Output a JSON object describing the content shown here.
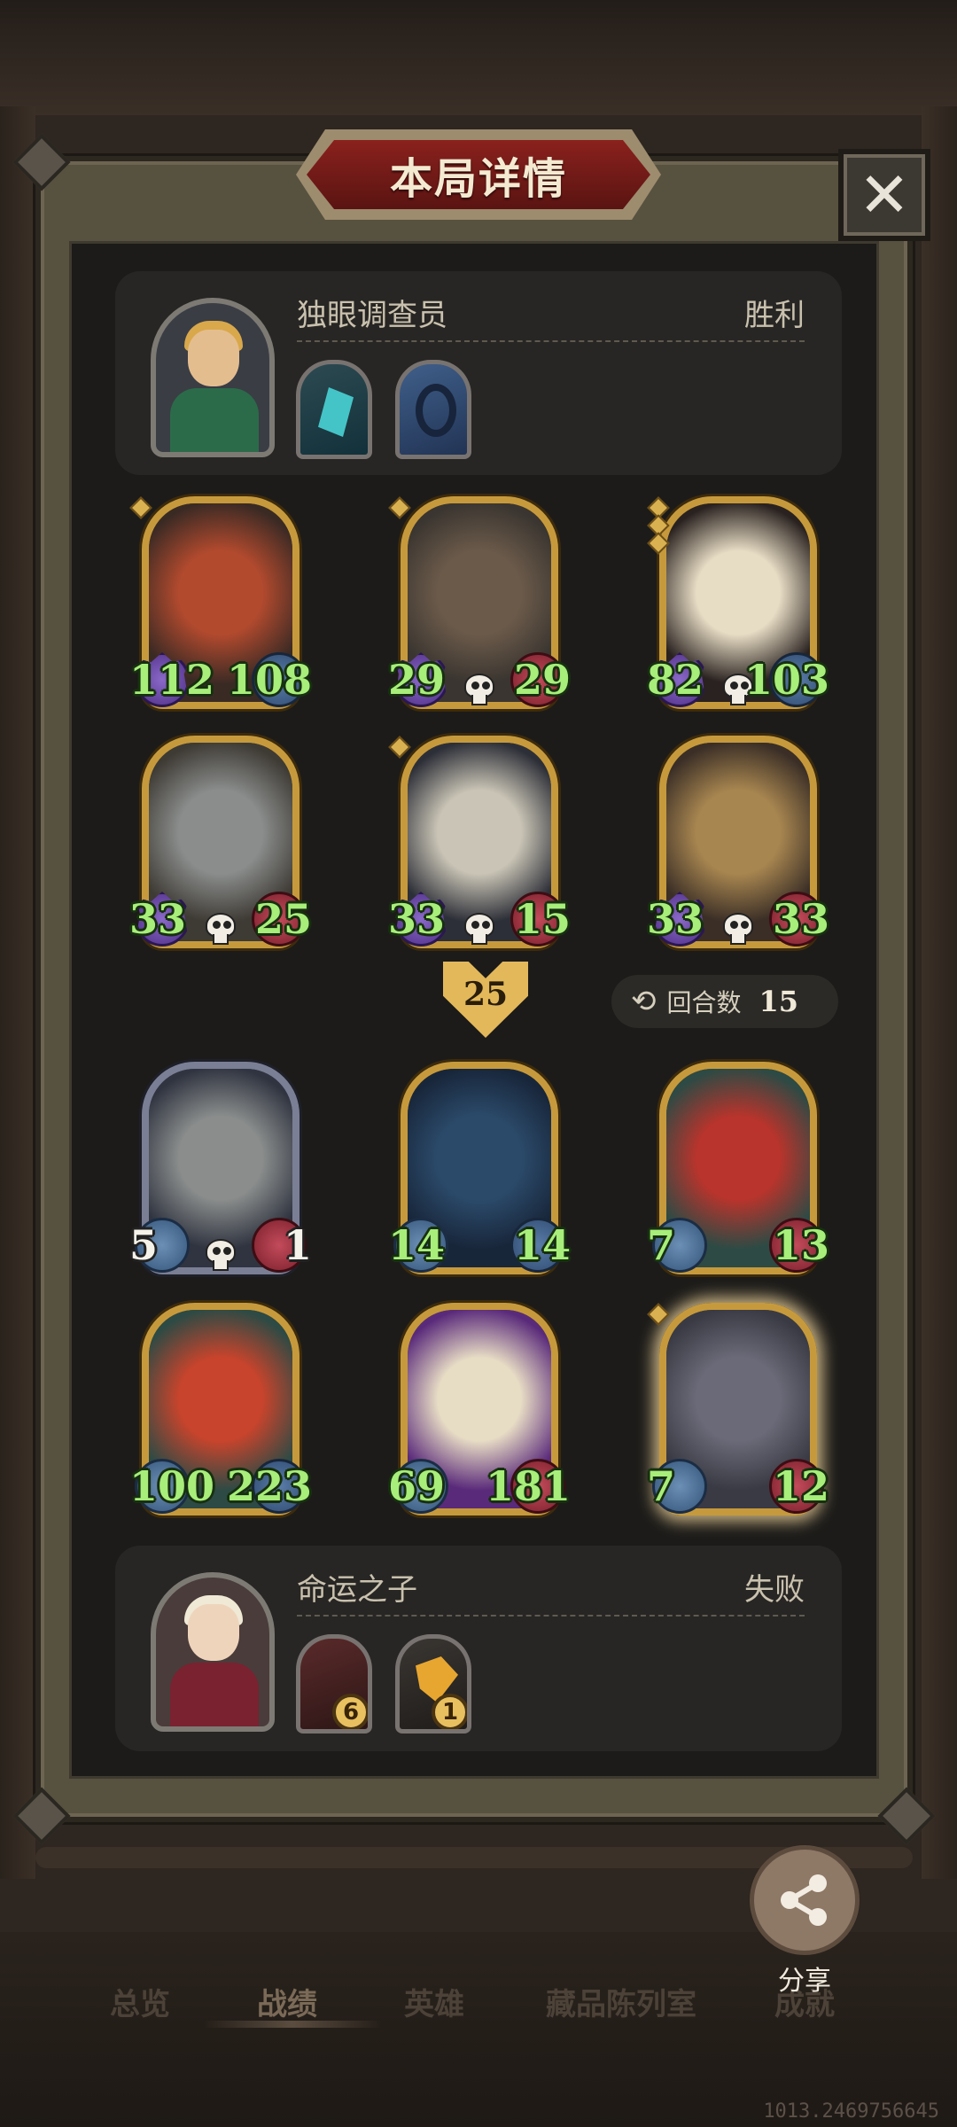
{
  "title": "本局详情",
  "close_symbol": "✕",
  "winner": {
    "name": "独眼调查员",
    "result": "胜利"
  },
  "loser": {
    "name": "命运之子",
    "result": "失败",
    "trinkets": [
      {
        "badge": "6"
      },
      {
        "badge": "1"
      }
    ]
  },
  "top_board": [
    {
      "attack": "112",
      "health": "108",
      "tier_pips": 1
    },
    {
      "attack": "29",
      "health": "29",
      "tier_pips": 1
    },
    {
      "attack": "82",
      "health": "103",
      "tier_pips": 3
    },
    {
      "attack": "33",
      "health": "25",
      "tier_pips": 0
    },
    {
      "attack": "33",
      "health": "15",
      "tier_pips": 1
    },
    {
      "attack": "33",
      "health": "33",
      "tier_pips": 0
    }
  ],
  "bottom_board": [
    {
      "attack": "5",
      "health": "1",
      "tier_pips": 0
    },
    {
      "attack": "14",
      "health": "14",
      "tier_pips": 0
    },
    {
      "attack": "7",
      "health": "13",
      "tier_pips": 0
    },
    {
      "attack": "100",
      "health": "223",
      "tier_pips": 0
    },
    {
      "attack": "69",
      "health": "181",
      "tier_pips": 0
    },
    {
      "attack": "7",
      "health": "12",
      "tier_pips": 1
    }
  ],
  "damage": "25",
  "round": {
    "label": "回合数",
    "value": "15"
  },
  "share_label": "分享",
  "nav": {
    "items": [
      "总览",
      "战绩",
      "英雄",
      "藏品陈列室",
      "成就"
    ],
    "active": "战绩"
  },
  "footer_id": "1013.2469756645",
  "colors": {
    "gold_frame": "#c69a3c",
    "stat_green": "#a8ee7a",
    "title_red": "#8a211d"
  }
}
